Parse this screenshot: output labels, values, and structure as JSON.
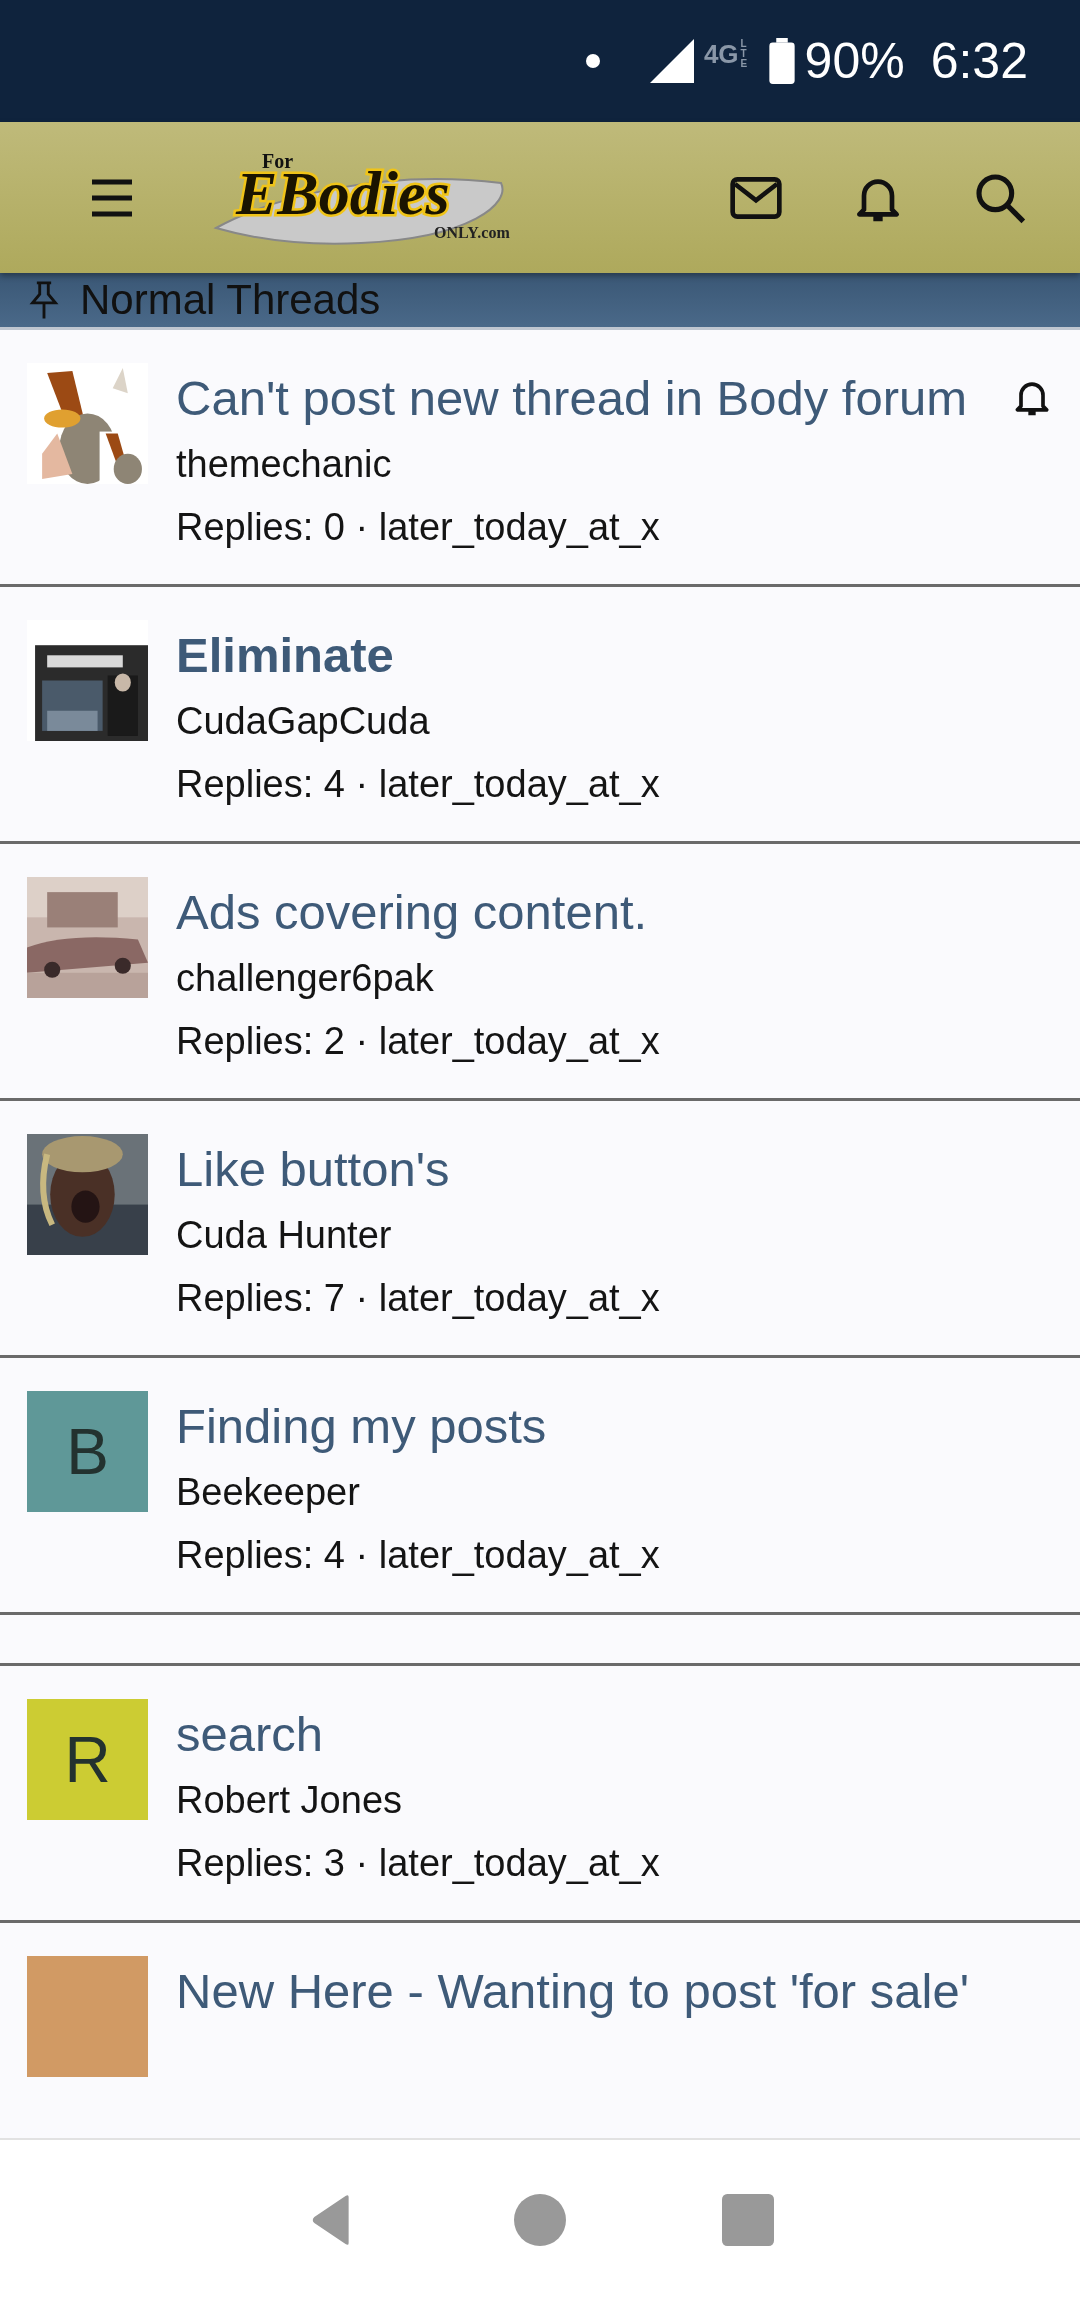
{
  "status_bar": {
    "network": "4G",
    "network_sub": "LTE",
    "battery": "90%",
    "time": "6:32"
  },
  "header": {
    "logo": {
      "top": "For",
      "main": "EBodies",
      "bottom": "ONLY.com"
    }
  },
  "section": {
    "title": "Normal Threads"
  },
  "threads": [
    {
      "kind": "thread",
      "title": "Can't post new thread in Body forum",
      "author": "themechanic",
      "meta": "Replies: 0 · later_today_at_x",
      "unread": false,
      "watched": true
    },
    {
      "kind": "thread",
      "title": "Eliminate",
      "author": "CudaGapCuda",
      "meta": "Replies: 4 · later_today_at_x",
      "unread": true,
      "watched": false
    },
    {
      "kind": "thread",
      "title": "Ads covering content.",
      "author": "challenger6pak",
      "meta": "Replies: 2 · later_today_at_x",
      "unread": false,
      "watched": false
    },
    {
      "kind": "thread",
      "title": "Like button's",
      "author": "Cuda Hunter",
      "meta": "Replies: 7 · later_today_at_x",
      "unread": false,
      "watched": false
    },
    {
      "kind": "thread",
      "avatar": {
        "kind": "letter",
        "letter": "B",
        "color": "#5f9898"
      },
      "title": "Finding my posts",
      "author": "Beekeeper",
      "meta": "Replies: 4 · later_today_at_x",
      "unread": false,
      "watched": false
    },
    {
      "kind": "gap"
    },
    {
      "kind": "thread",
      "avatar": {
        "kind": "letter",
        "letter": "R",
        "color": "#cccc33"
      },
      "title": "search",
      "author": "Robert Jones",
      "meta": "Replies: 3 · later_today_at_x",
      "unread": false,
      "watched": false
    },
    {
      "kind": "partial",
      "avatar": {
        "kind": "letter",
        "color": "#d19a64"
      },
      "title": "New Here - Wanting to post 'for sale'",
      "unread": false,
      "watched": false
    }
  ]
}
